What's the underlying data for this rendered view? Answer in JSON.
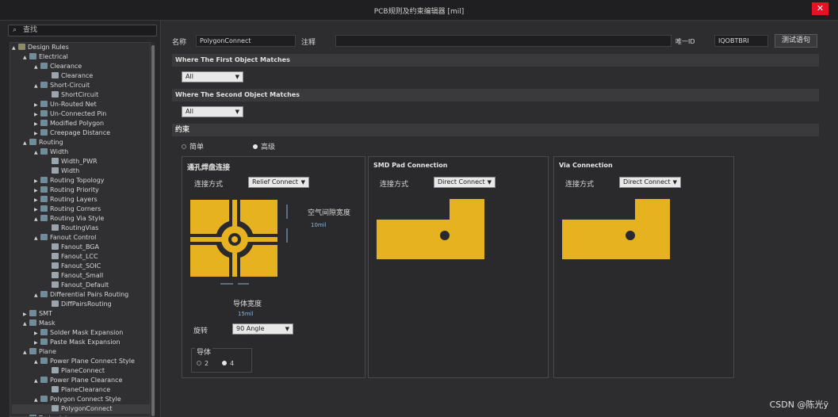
{
  "window": {
    "title": "PCB规则及约束编辑器 [mil]",
    "close_glyph": "✕"
  },
  "search": {
    "placeholder": "查找"
  },
  "tree": [
    {
      "label": "Design Rules",
      "depth": 0,
      "arrow": "▲",
      "kind": "folder"
    },
    {
      "label": "Electrical",
      "depth": 1,
      "arrow": "▲",
      "kind": "rule"
    },
    {
      "label": "Clearance",
      "depth": 2,
      "arrow": "▲",
      "kind": "rule"
    },
    {
      "label": "Clearance",
      "depth": 3,
      "arrow": "",
      "kind": "item"
    },
    {
      "label": "Short-Circuit",
      "depth": 2,
      "arrow": "▲",
      "kind": "rule"
    },
    {
      "label": "ShortCircuit",
      "depth": 3,
      "arrow": "",
      "kind": "item"
    },
    {
      "label": "Un-Routed Net",
      "depth": 2,
      "arrow": "▶",
      "kind": "rule"
    },
    {
      "label": "Un-Connected Pin",
      "depth": 2,
      "arrow": "▶",
      "kind": "rule"
    },
    {
      "label": "Modified Polygon",
      "depth": 2,
      "arrow": "▶",
      "kind": "rule"
    },
    {
      "label": "Creepage Distance",
      "depth": 2,
      "arrow": "▶",
      "kind": "rule"
    },
    {
      "label": "Routing",
      "depth": 1,
      "arrow": "▲",
      "kind": "rule"
    },
    {
      "label": "Width",
      "depth": 2,
      "arrow": "▲",
      "kind": "rule"
    },
    {
      "label": "Width_PWR",
      "depth": 3,
      "arrow": "",
      "kind": "item"
    },
    {
      "label": "Width",
      "depth": 3,
      "arrow": "",
      "kind": "item"
    },
    {
      "label": "Routing Topology",
      "depth": 2,
      "arrow": "▶",
      "kind": "rule"
    },
    {
      "label": "Routing Priority",
      "depth": 2,
      "arrow": "▶",
      "kind": "rule"
    },
    {
      "label": "Routing Layers",
      "depth": 2,
      "arrow": "▶",
      "kind": "rule"
    },
    {
      "label": "Routing Corners",
      "depth": 2,
      "arrow": "▶",
      "kind": "rule"
    },
    {
      "label": "Routing Via Style",
      "depth": 2,
      "arrow": "▲",
      "kind": "rule"
    },
    {
      "label": "RoutingVias",
      "depth": 3,
      "arrow": "",
      "kind": "item"
    },
    {
      "label": "Fanout Control",
      "depth": 2,
      "arrow": "▲",
      "kind": "rule"
    },
    {
      "label": "Fanout_BGA",
      "depth": 3,
      "arrow": "",
      "kind": "item"
    },
    {
      "label": "Fanout_LCC",
      "depth": 3,
      "arrow": "",
      "kind": "item"
    },
    {
      "label": "Fanout_SOIC",
      "depth": 3,
      "arrow": "",
      "kind": "item"
    },
    {
      "label": "Fanout_Small",
      "depth": 3,
      "arrow": "",
      "kind": "item"
    },
    {
      "label": "Fanout_Default",
      "depth": 3,
      "arrow": "",
      "kind": "item"
    },
    {
      "label": "Differential Pairs Routing",
      "depth": 2,
      "arrow": "▲",
      "kind": "rule"
    },
    {
      "label": "DiffPairsRouting",
      "depth": 3,
      "arrow": "",
      "kind": "item"
    },
    {
      "label": "SMT",
      "depth": 1,
      "arrow": "▶",
      "kind": "rule"
    },
    {
      "label": "Mask",
      "depth": 1,
      "arrow": "▲",
      "kind": "rule"
    },
    {
      "label": "Solder Mask Expansion",
      "depth": 2,
      "arrow": "▶",
      "kind": "rule"
    },
    {
      "label": "Paste Mask Expansion",
      "depth": 2,
      "arrow": "▶",
      "kind": "rule"
    },
    {
      "label": "Plane",
      "depth": 1,
      "arrow": "▲",
      "kind": "rule"
    },
    {
      "label": "Power Plane Connect Style",
      "depth": 2,
      "arrow": "▲",
      "kind": "rule"
    },
    {
      "label": "PlaneConnect",
      "depth": 3,
      "arrow": "",
      "kind": "item"
    },
    {
      "label": "Power Plane Clearance",
      "depth": 2,
      "arrow": "▲",
      "kind": "rule"
    },
    {
      "label": "PlaneClearance",
      "depth": 3,
      "arrow": "",
      "kind": "item"
    },
    {
      "label": "Polygon Connect Style",
      "depth": 2,
      "arrow": "▲",
      "kind": "rule"
    },
    {
      "label": "PolygonConnect",
      "depth": 3,
      "arrow": "",
      "kind": "item",
      "selected": true
    },
    {
      "label": "Testpoint",
      "depth": 1,
      "arrow": "▶",
      "kind": "rule"
    }
  ],
  "header": {
    "name_label": "名称",
    "name_value": "PolygonConnect",
    "comment_label": "注释",
    "comment_value": "",
    "uid_label": "唯一ID",
    "uid_value": "IQOBTBRI",
    "test_button": "测试语句"
  },
  "first_match": {
    "title": "Where The First Object Matches",
    "value": "All"
  },
  "second_match": {
    "title": "Where The Second Object Matches",
    "value": "All"
  },
  "constraints": {
    "title": "约束",
    "mode_simple": "简单",
    "mode_advanced": "高级",
    "via_pad": {
      "title": "通孔焊盘连接",
      "connect_label": "连接方式",
      "connect_value": "Relief Connect",
      "air_gap_label": "空气间隙宽度",
      "air_gap_value": "10mil",
      "conductor_width_label": "导体宽度",
      "conductor_width_value": "15mil",
      "rotation_label": "旋转",
      "rotation_value": "90 Angle",
      "conductors_label": "导体",
      "conductors_opt1": "2",
      "conductors_opt2": "4"
    },
    "smd_pad": {
      "title": "SMD Pad Connection",
      "connect_label": "连接方式",
      "connect_value": "Direct Connect"
    },
    "via": {
      "title": "Via Connection",
      "connect_label": "连接方式",
      "connect_value": "Direct Connect"
    }
  },
  "watermark": "CSDN @陈光ÿ",
  "colors": {
    "copper": "#e6b21f",
    "background": "#2b2b2d"
  }
}
